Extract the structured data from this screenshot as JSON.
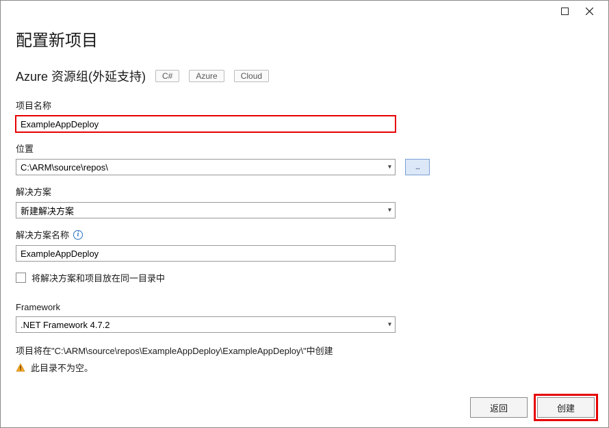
{
  "window": {
    "title": "配置新项目",
    "subtitle": "Azure 资源组(外延支持)",
    "tags": [
      "C#",
      "Azure",
      "Cloud"
    ]
  },
  "fields": {
    "projectName": {
      "label": "项目名称",
      "value": "ExampleAppDeploy"
    },
    "location": {
      "label": "位置",
      "value": "C:\\ARM\\source\\repos\\",
      "browse": "..."
    },
    "solution": {
      "label": "解决方案",
      "value": "新建解决方案"
    },
    "solutionName": {
      "label": "解决方案名称",
      "value": "ExampleAppDeploy"
    },
    "sameDir": {
      "label": "将解决方案和项目放在同一目录中"
    },
    "framework": {
      "label": "Framework",
      "value": ".NET Framework 4.7.2"
    }
  },
  "notes": {
    "path": "项目将在\"C:\\ARM\\source\\repos\\ExampleAppDeploy\\ExampleAppDeploy\\\"中创建",
    "warning": "此目录不为空。"
  },
  "footer": {
    "back": "返回",
    "create": "创建"
  }
}
